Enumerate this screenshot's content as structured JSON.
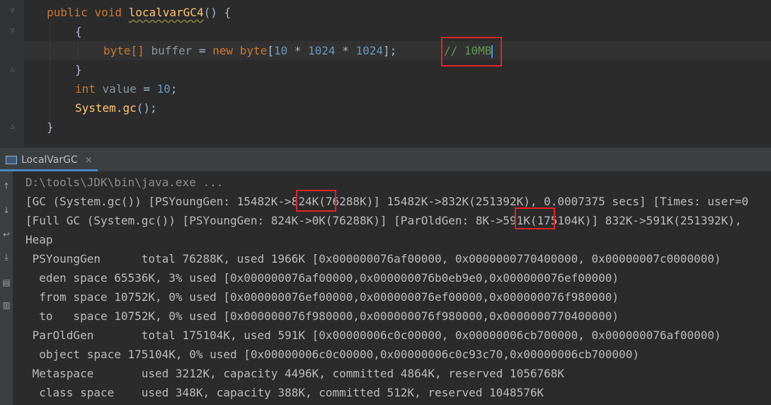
{
  "editor": {
    "line1": {
      "kw1": "public",
      "kw2": "void",
      "name": "localvarGC4",
      "rest": "() {"
    },
    "line2": "{",
    "line3": {
      "type": "byte[]",
      "var": "buffer",
      "eq": " = ",
      "new": "new",
      "type2": "byte",
      "b1": "[",
      "n1": "10",
      "op1": " * ",
      "n2": "1024",
      "op2": " * ",
      "n3": "1024",
      "end": "];",
      "comment": "// 10MB"
    },
    "line4": "}",
    "line5": {
      "kw": "int",
      "var": "value",
      "eq": " = ",
      "num": "10",
      "end": ";"
    },
    "line6": {
      "cls": "System.",
      "fn": "gc",
      "end": "();"
    },
    "line7": "}"
  },
  "run_tab": {
    "label": "LocalVarGC",
    "close": "×"
  },
  "console": {
    "cmd": "D:\\tools\\JDK\\bin\\java.exe ...",
    "gc1": {
      "pre": "[GC (System.gc()) [PSYoungGen: 15482K-",
      "mark": ">824K",
      "post": "(76288K)] 15482K->832K(251392K), 0.0007375 secs] [Times: user=0"
    },
    "gc2": {
      "pre": "[Full GC (System.gc()) [PSYoungGen: 824K->0K(76288K)] [ParOldGen: 8K-",
      "mark": ">591K",
      "post": "(175104K)] 832K->591K(251392K),"
    },
    "lines": [
      "Heap",
      " PSYoungGen      total 76288K, used 1966K [0x000000076af00000, 0x0000000770400000, 0x00000007c0000000)",
      "  eden space 65536K, 3% used [0x000000076af00000,0x000000076b0eb9e0,0x000000076ef00000)",
      "  from space 10752K, 0% used [0x000000076ef00000,0x000000076ef00000,0x000000076f980000)",
      "  to   space 10752K, 0% used [0x000000076f980000,0x000000076f980000,0x0000000770400000)",
      " ParOldGen       total 175104K, used 591K [0x00000006c0c00000, 0x00000006cb700000, 0x000000076af00000)",
      "  object space 175104K, 0% used [0x00000006c0c00000,0x00000006c0c93c70,0x00000006cb700000)",
      " Metaspace       used 3212K, capacity 4496K, committed 4864K, reserved 1056768K",
      "  class space    used 348K, capacity 388K, committed 512K, reserved 1048576K"
    ]
  },
  "colors": {
    "keyword": "#cc7832",
    "function": "#ffc66d",
    "number": "#6897bb",
    "comment": "#629755",
    "highlight": "#e0232b"
  },
  "icons": [
    "fold-marker-icon",
    "console-window-icon",
    "close-icon",
    "rerun-up-icon",
    "rerun-down-icon",
    "soft-wrap-icon",
    "scroll-to-end-icon",
    "print-icon",
    "trash-icon"
  ]
}
